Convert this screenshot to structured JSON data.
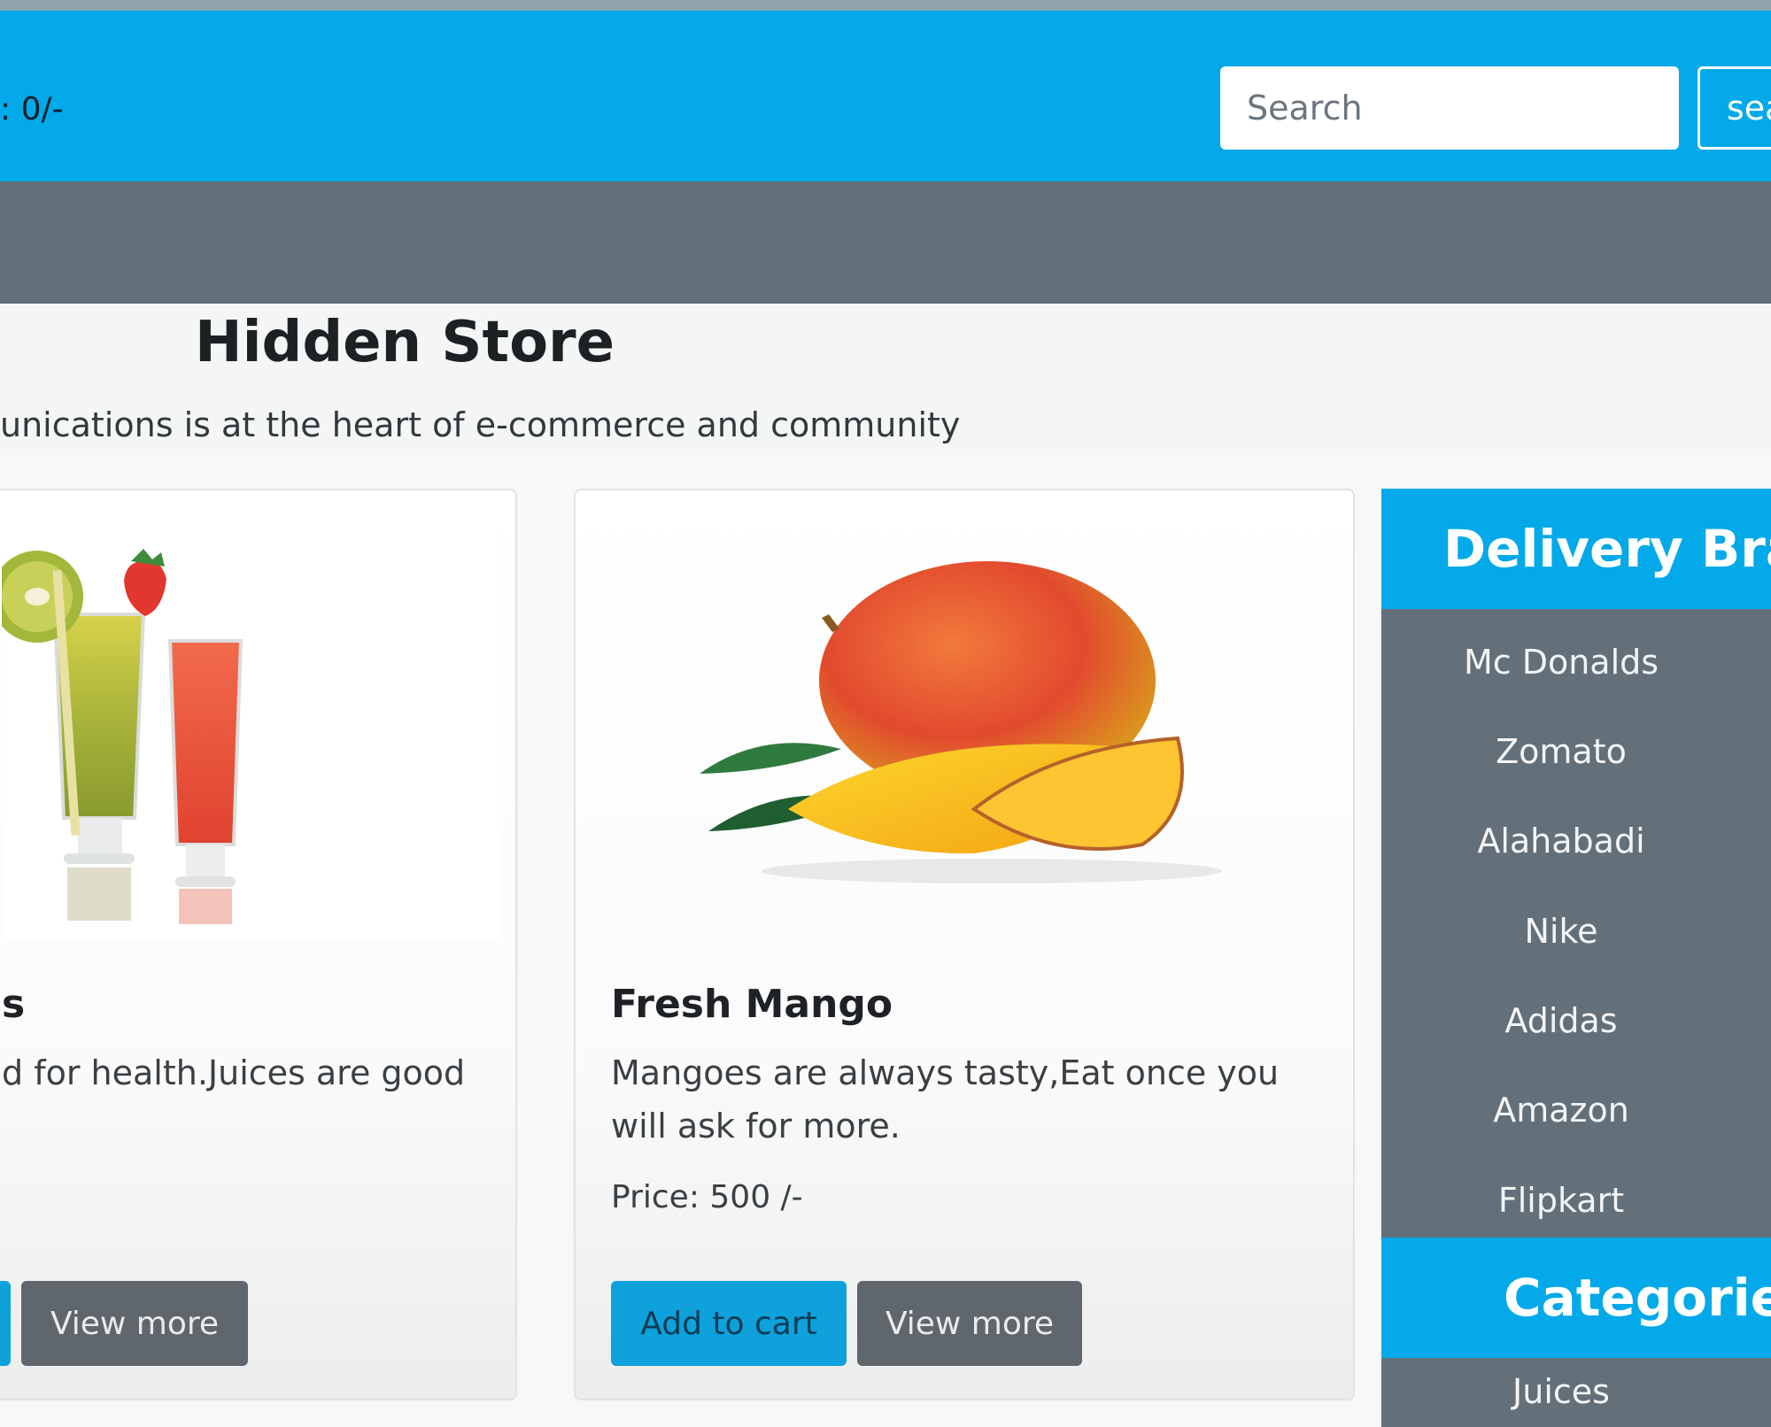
{
  "navbar": {
    "cart_total": ": 0/-",
    "search_placeholder": "Search",
    "search_button": "sea"
  },
  "hero": {
    "title": "Hidden Store",
    "lead": "unications is at the heart of e-commerce and community"
  },
  "products": [
    {
      "title": "s",
      "description": "d for health.Juices are good",
      "view_more": "View more"
    },
    {
      "title": "Fresh Mango",
      "description": "Mangoes are always tasty,Eat once you will ask for more.",
      "price": "Price: 500 /-",
      "add_to_cart": "Add to cart",
      "view_more": "View more"
    }
  ],
  "sidebar": {
    "brands_header": "Delivery Branc",
    "brands": [
      "Mc Donalds",
      "Zomato",
      "Alahabadi",
      "Nike",
      "Adidas",
      "Amazon",
      "Flipkart"
    ],
    "categories_header": "Categories",
    "categories": [
      "Juices"
    ]
  },
  "colors": {
    "primary": "#03a9e8",
    "secondary": "#636f79"
  },
  "icons": {
    "juice": "juice-glasses-image",
    "mango": "mango-image"
  }
}
